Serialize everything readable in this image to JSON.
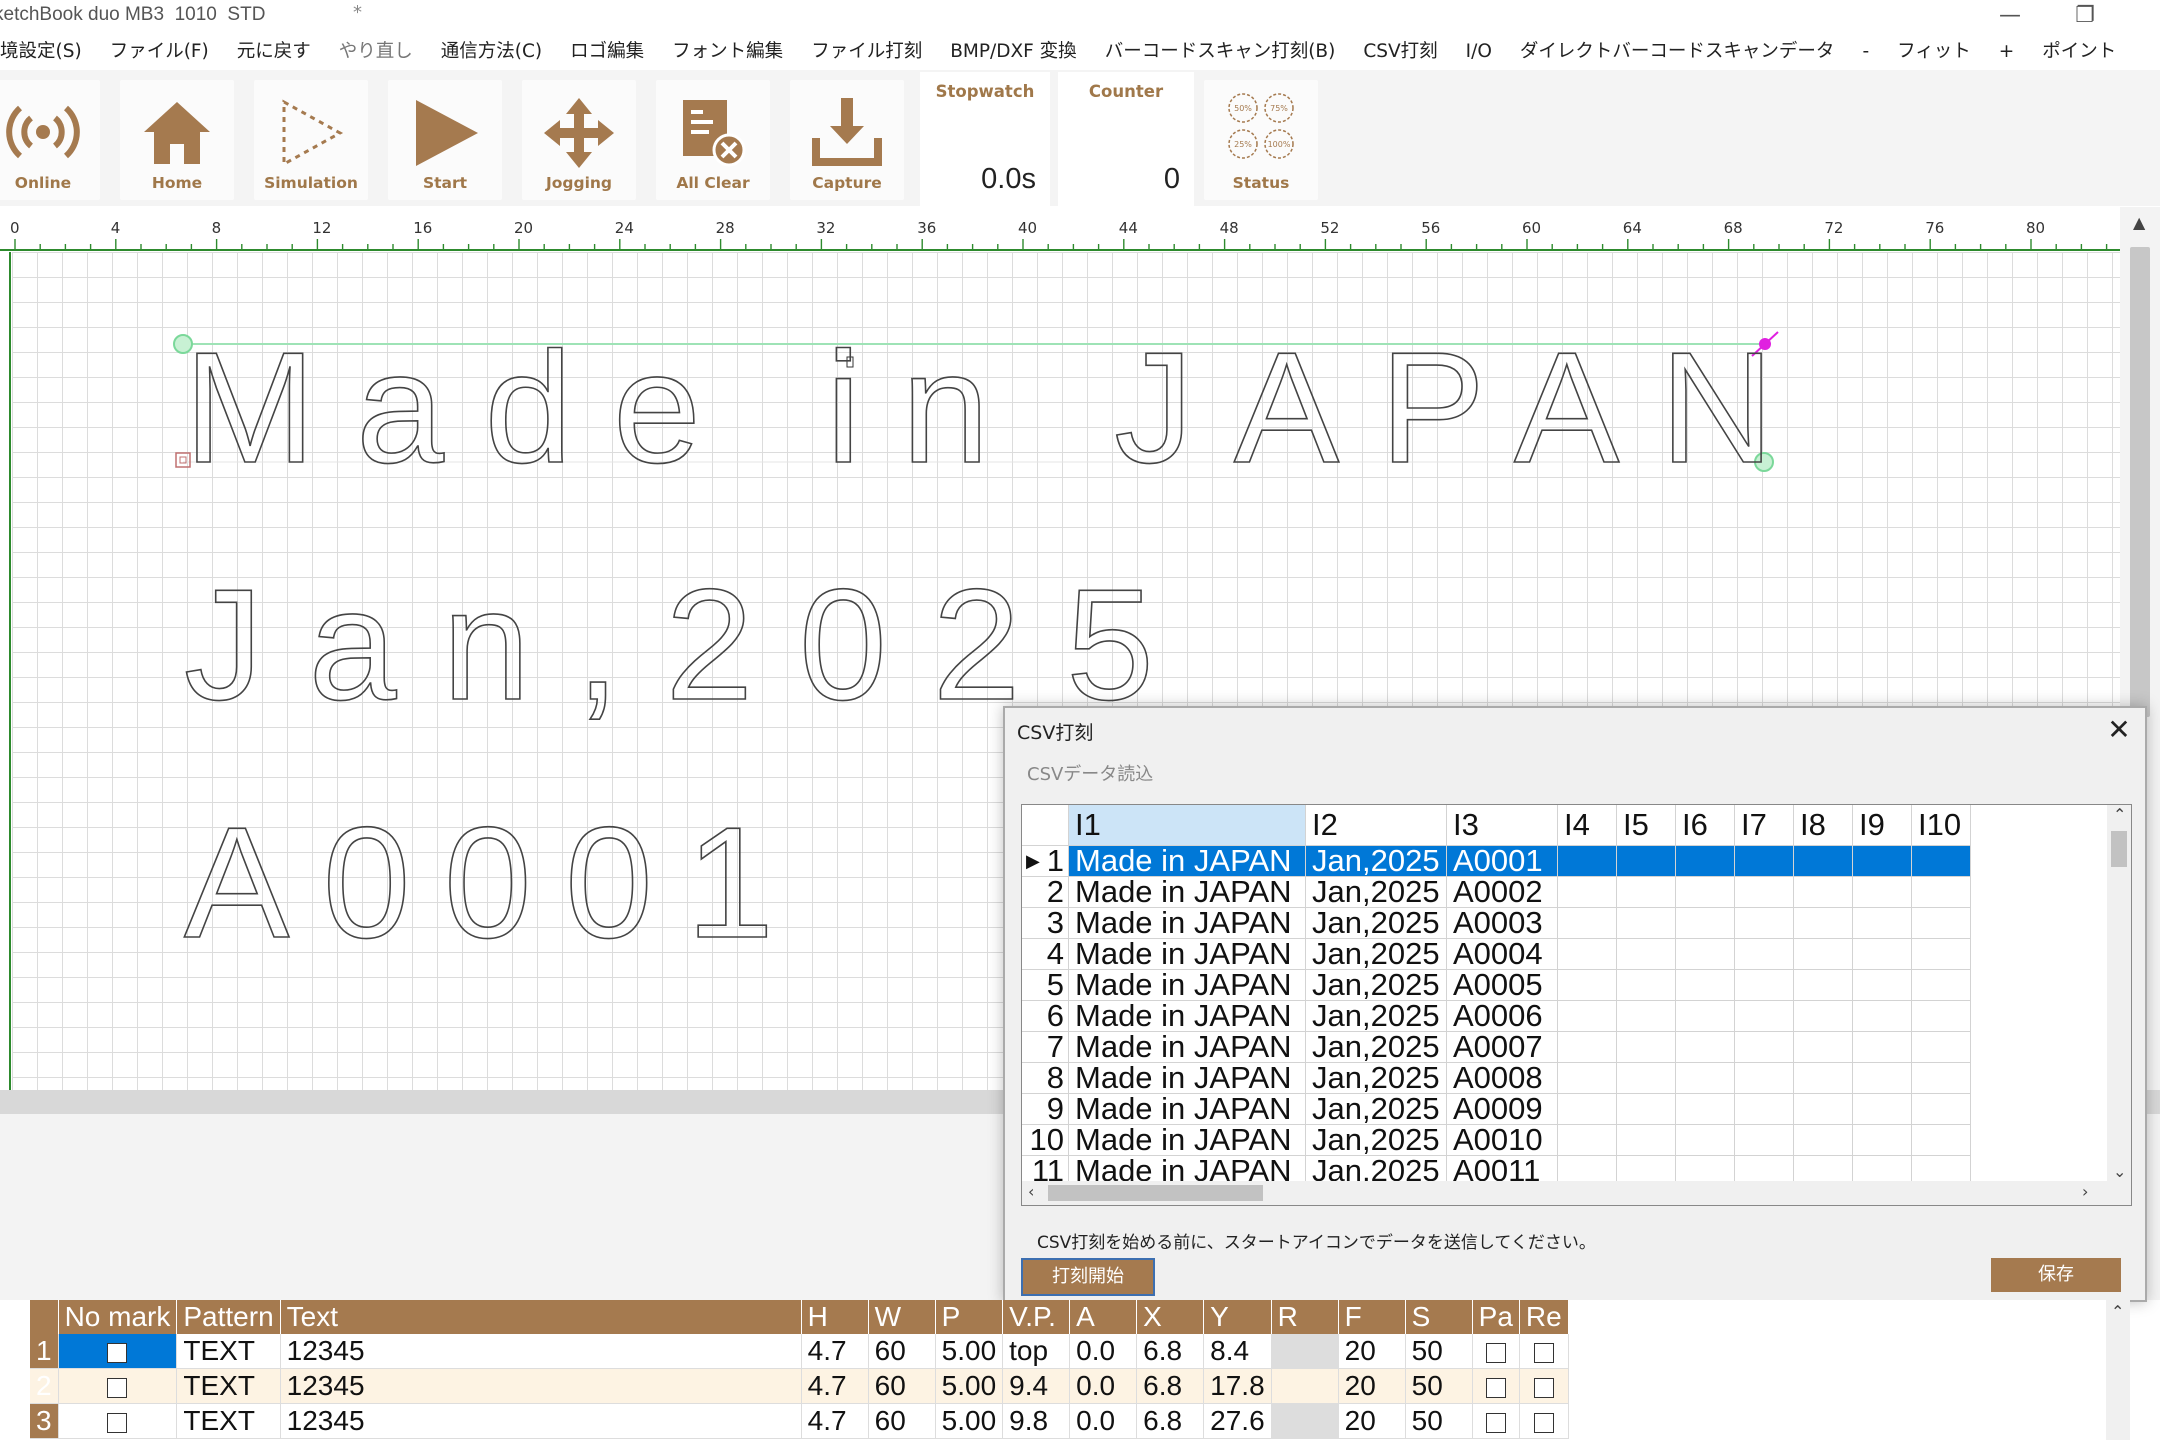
{
  "window": {
    "title": "ketchBook duo MB3  1010  STD",
    "modified_marker": "*",
    "minimize_glyph": "—",
    "restore_glyph": "❐"
  },
  "menu": [
    {
      "label": "境設定(S)",
      "dim": false
    },
    {
      "label": "ファイル(F)",
      "dim": false
    },
    {
      "label": "元に戻す",
      "dim": false
    },
    {
      "label": "やり直し",
      "dim": true
    },
    {
      "label": "通信方法(C)",
      "dim": false
    },
    {
      "label": "ロゴ編集",
      "dim": false
    },
    {
      "label": "フォント編集",
      "dim": false
    },
    {
      "label": "ファイル打刻",
      "dim": false
    },
    {
      "label": "BMP/DXF 変換",
      "dim": false
    },
    {
      "label": "バーコードスキャン打刻(B)",
      "dim": false
    },
    {
      "label": "CSV打刻",
      "dim": false
    },
    {
      "label": "I/O",
      "dim": false
    },
    {
      "label": "ダイレクトバーコードスキャンデータ",
      "dim": false
    },
    {
      "label": "-",
      "dim": false
    },
    {
      "label": "フィット",
      "dim": false
    },
    {
      "label": "+",
      "dim": false
    },
    {
      "label": "ポイント",
      "dim": false
    }
  ],
  "toolbar": {
    "online": "Online",
    "home": "Home",
    "simulation": "Simulation",
    "start": "Start",
    "jogging": "Jogging",
    "all_clear": "All Clear",
    "capture": "Capture",
    "stopwatch_title": "Stopwatch",
    "stopwatch_value": "0.0s",
    "counter_title": "Counter",
    "counter_value": "0",
    "status": "Status",
    "status_dials": [
      "50%",
      "75%",
      "25%",
      "100%"
    ]
  },
  "ruler": [
    "0",
    "4",
    "8",
    "12",
    "16",
    "20",
    "24",
    "28",
    "32",
    "36",
    "40",
    "44",
    "48",
    "52",
    "56",
    "60",
    "64",
    "68",
    "72",
    "76",
    "80"
  ],
  "canvas": {
    "line1": "Made in JAPAN",
    "line2": "Jan,2025",
    "line3": "A0001"
  },
  "accent_color": "#a57a4f",
  "selection_color": "#0078d7",
  "csv_dialog": {
    "title": "CSV打刻",
    "close": "✕",
    "subtitle": "CSVデータ読込",
    "columns": [
      "I1",
      "I2",
      "I3",
      "I4",
      "I5",
      "I6",
      "I7",
      "I8",
      "I9",
      "I10"
    ],
    "rows": [
      {
        "n": "1",
        "c": [
          "Made in JAPAN",
          "Jan,2025",
          "A0001"
        ]
      },
      {
        "n": "2",
        "c": [
          "Made in JAPAN",
          "Jan,2025",
          "A0002"
        ]
      },
      {
        "n": "3",
        "c": [
          "Made in JAPAN",
          "Jan,2025",
          "A0003"
        ]
      },
      {
        "n": "4",
        "c": [
          "Made in JAPAN",
          "Jan,2025",
          "A0004"
        ]
      },
      {
        "n": "5",
        "c": [
          "Made in JAPAN",
          "Jan,2025",
          "A0005"
        ]
      },
      {
        "n": "6",
        "c": [
          "Made in JAPAN",
          "Jan,2025",
          "A0006"
        ]
      },
      {
        "n": "7",
        "c": [
          "Made in JAPAN",
          "Jan,2025",
          "A0007"
        ]
      },
      {
        "n": "8",
        "c": [
          "Made in JAPAN",
          "Jan,2025",
          "A0008"
        ]
      },
      {
        "n": "9",
        "c": [
          "Made in JAPAN",
          "Jan,2025",
          "A0009"
        ]
      },
      {
        "n": "10",
        "c": [
          "Made in JAPAN",
          "Jan,2025",
          "A0010"
        ]
      },
      {
        "n": "11",
        "c": [
          "Made in JAPAN",
          "Jan,2025",
          "A0011"
        ]
      }
    ],
    "note": "CSV打刻を始める前に、スタートアイコンでデータを送信してください。",
    "start_button": "打刻開始",
    "save_button": "保存"
  },
  "pattern_table": {
    "columns": [
      "",
      "No mark",
      "Pattern",
      "Text",
      "H",
      "W",
      "P",
      "V.P.",
      "A",
      "X",
      "Y",
      "R",
      "F",
      "S",
      "Pa",
      "Re"
    ],
    "rows": [
      {
        "n": "1",
        "pattern": "TEXT",
        "text": "12345",
        "h": "4.7",
        "w": "60",
        "p": "5.00",
        "vp": "top",
        "a": "0.0",
        "x": "6.8",
        "y": "8.4",
        "r": "",
        "f": "20",
        "s": "50"
      },
      {
        "n": "2",
        "pattern": "TEXT",
        "text": "12345",
        "h": "4.7",
        "w": "60",
        "p": "5.00",
        "vp": "9.4",
        "a": "0.0",
        "x": "6.8",
        "y": "17.8",
        "r": "",
        "f": "20",
        "s": "50"
      },
      {
        "n": "3",
        "pattern": "TEXT",
        "text": "12345",
        "h": "4.7",
        "w": "60",
        "p": "5.00",
        "vp": "9.8",
        "a": "0.0",
        "x": "6.8",
        "y": "27.6",
        "r": "",
        "f": "20",
        "s": "50"
      }
    ]
  }
}
